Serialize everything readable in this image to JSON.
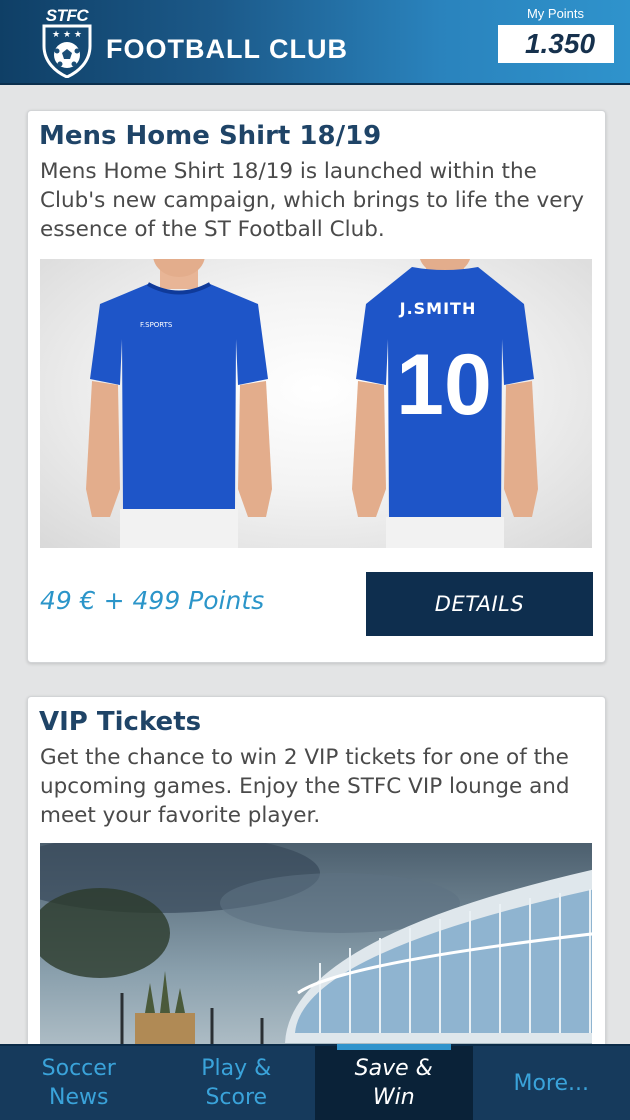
{
  "header": {
    "logo_text": "STFC",
    "title": "FOOTBALL CLUB",
    "points_label": "My Points",
    "points_value": "1.350"
  },
  "cards": [
    {
      "title": "Mens Home Shirt 18/19",
      "text": "Mens Home Shirt 18/19 is launched within the Club's new campaign, which brings to life the very essence of the ST Football Club.",
      "image": {
        "chest_logo": "F.SPORTS",
        "back_name": "J.SMITH",
        "back_number": "10"
      },
      "price": "49 € + 499 Points",
      "button_label": "DETAILS"
    },
    {
      "title": "VIP Tickets",
      "text": "Get the chance to win 2 VIP tickets for one of the upcoming games. Enjoy the STFC VIP lounge and meet your favorite player."
    }
  ],
  "nav": {
    "items": [
      {
        "label": "Soccer\nNews",
        "active": false
      },
      {
        "label": "Play &\nScore",
        "active": false
      },
      {
        "label": "Save &\nWin",
        "active": true
      },
      {
        "label": "More...",
        "active": false
      }
    ]
  },
  "colors": {
    "header_dark": "#0f3f66",
    "header_light": "#2f93cc",
    "title_blue": "#1f4467",
    "price_blue": "#2b95c9",
    "button_navy": "#0e2e4e",
    "nav_bg": "#163a5c",
    "nav_text": "#3aa3da"
  }
}
